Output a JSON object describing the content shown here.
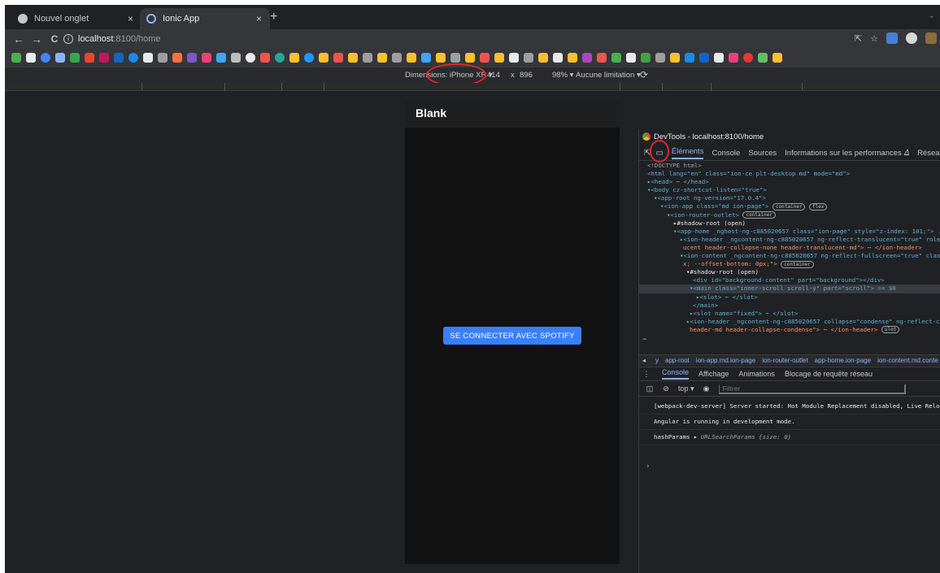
{
  "tabs": [
    {
      "label": "Nouvel onglet",
      "icon": "chrome-icon",
      "active": false
    },
    {
      "label": "Ionic App",
      "icon": "ionic-icon",
      "active": true
    }
  ],
  "tab_close_glyph": "×",
  "new_tab_glyph": "+",
  "address": {
    "info": "i",
    "host": "localhost",
    "path": ":8100/home"
  },
  "nav": {
    "back": "←",
    "forward": "→",
    "reload": "C"
  },
  "device_toolbar": {
    "dimensions": "Dimensions: iPhone XR ▾",
    "width": "414",
    "x": "x",
    "height": "896",
    "zoom": "98% ▾",
    "throttle": "Aucune limitation ▾"
  },
  "app": {
    "title": "Blank",
    "button": "SE CONNECTER AVEC SPOTIFY"
  },
  "devtools": {
    "title": "DevTools - localhost:8100/home",
    "tabs": [
      "Éléments",
      "Console",
      "Sources",
      "Informations sur les performances 𝛥",
      "Réseau"
    ],
    "dom": [
      {
        "t": "<!DOCTYPE html>"
      },
      {
        "t": "<html lang=\"en\" class=\"ion-ce plt-desktop md\" mode=\"md\">"
      },
      {
        "t": "▸<head> ⋯ </head>"
      },
      {
        "t": "▾<body cz-shortcut-listen=\"true\">"
      },
      {
        "t": "▾<app-root ng-version=\"17.0.4\">"
      },
      {
        "t": "▾<ion-app class=\"md ion-page\">"
      },
      {
        "t": "▾<ion-router-outlet>"
      },
      {
        "t": "▸#shadow-root (open)"
      },
      {
        "t": "▾<app-home _nghost-ng-c885020657 class=\"ion-page\" style=\"z-index: 101;\">"
      },
      {
        "t": "▸<ion-header _ngcontent-ng-c885020657 ng-reflect-translucent=\"true\" role=\""
      },
      {
        "t": "ucent header-collapse-none header-translucent-md\"> ⋯ </ion-header>"
      },
      {
        "t": "▾<ion-content _ngcontent-ng-c885020657 ng-reflect-fullscreen=\"true\" class="
      },
      {
        "t": "x; --offset-bottom: 0px;\">"
      },
      {
        "t": "▾#shadow-root (open)"
      },
      {
        "t": "<div id=\"background-content\" part=\"background\"></div>"
      },
      {
        "t": "▾<main class=\"inner-scroll scroll-y\" part=\"scroll\"> == $0"
      },
      {
        "t": "▸<slot> ⋯ </slot>"
      },
      {
        "t": "</main>"
      },
      {
        "t": "▸<slot name=\"fixed\"> ⋯ </slot>"
      },
      {
        "t": "▸<ion-header _ngcontent-ng-c885020657 collapse=\"condense\" ng-reflect-col"
      },
      {
        "t": "header-md header-collapse-condense\"> ⋯ </ion-header>"
      }
    ],
    "badges": {
      "container": "container",
      "flex": "flex",
      "slot": "slot"
    },
    "crumbs": [
      "y",
      "app-root",
      "ion-app.md.ion-page",
      "ion-router-outlet",
      "app-home.ion-page",
      "ion-content.md.conte"
    ],
    "drawer_tabs": [
      "Console",
      "Affichage",
      "Animations",
      "Blocage de requête réseau"
    ],
    "console_context": "top ▾",
    "filter_placeholder": "Filtrer",
    "messages": [
      "[webpack-dev-server] Server started: Hot Module Replacement disabled, Live Reload",
      "Angular is running in development mode."
    ],
    "hashparams": {
      "name": "hashParams",
      "value": "URLSearchParams {size: 0}"
    },
    "prompt": "›",
    "ellipsis": "⋯"
  },
  "colors": {
    "annotation": "#e0262a",
    "ionic_primary": "#3880ff",
    "devtools_accent": "#8ab4f8"
  }
}
